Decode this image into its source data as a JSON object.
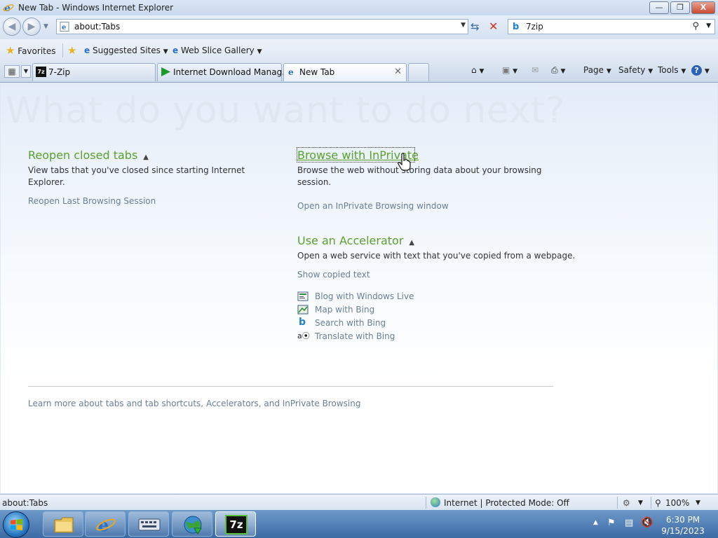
{
  "window": {
    "title": "New Tab - Windows Internet Explorer",
    "min_glyph": "—",
    "max_glyph": "❐",
    "close_glyph": "X"
  },
  "address": {
    "url": "about:Tabs"
  },
  "search": {
    "value": "7zip"
  },
  "favorites_bar": {
    "favorites_label": "Favorites",
    "suggested_sites_label": "Suggested Sites",
    "web_slice_gallery_label": "Web Slice Gallery"
  },
  "tabs": [
    {
      "label": "7-Zip"
    },
    {
      "label": "Internet Download Manag..."
    },
    {
      "label": "New Tab"
    }
  ],
  "command_bar": {
    "page_label": "Page",
    "safety_label": "Safety",
    "tools_label": "Tools"
  },
  "content": {
    "hero": "What do you want to do next?",
    "reopen": {
      "heading": "Reopen closed tabs",
      "description": "View tabs that you've closed since starting Internet Explorer.",
      "link": "Reopen Last Browsing Session"
    },
    "inprivate": {
      "heading": "Browse with InPrivate",
      "description": "Browse the web without storing data about your browsing session.",
      "link": "Open an InPrivate Browsing window"
    },
    "accelerator": {
      "heading": "Use an Accelerator",
      "description": "Open a web service with text that you've copied from a webpage.",
      "show_copied": "Show copied text",
      "items": [
        {
          "label": "Blog with Windows Live",
          "icon": "blog-icon"
        },
        {
          "label": "Map with Bing",
          "icon": "map-icon"
        },
        {
          "label": "Search with Bing",
          "icon": "bing-icon"
        },
        {
          "label": "Translate with Bing",
          "icon": "translate-icon"
        }
      ]
    },
    "learn_more": "Learn more about tabs and tab shortcuts, Accelerators, and InPrivate Browsing"
  },
  "status": {
    "left": "about:Tabs",
    "zone": "Internet | Protected Mode: Off",
    "zoom": "100%"
  },
  "taskbar": {
    "time": "6:30 PM",
    "date": "9/15/2023",
    "seven_zip_label": "7z"
  },
  "colors": {
    "heading_green": "#5aa02c",
    "link_gray": "#6a7e99"
  }
}
